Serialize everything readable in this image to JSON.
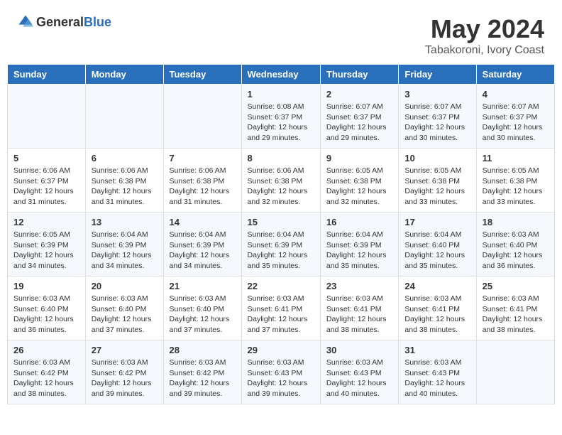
{
  "header": {
    "logo_general": "General",
    "logo_blue": "Blue",
    "month_year": "May 2024",
    "location": "Tabakoroni, Ivory Coast"
  },
  "weekdays": [
    "Sunday",
    "Monday",
    "Tuesday",
    "Wednesday",
    "Thursday",
    "Friday",
    "Saturday"
  ],
  "weeks": [
    [
      {
        "day": "",
        "info": ""
      },
      {
        "day": "",
        "info": ""
      },
      {
        "day": "",
        "info": ""
      },
      {
        "day": "1",
        "info": "Sunrise: 6:08 AM\nSunset: 6:37 PM\nDaylight: 12 hours\nand 29 minutes."
      },
      {
        "day": "2",
        "info": "Sunrise: 6:07 AM\nSunset: 6:37 PM\nDaylight: 12 hours\nand 29 minutes."
      },
      {
        "day": "3",
        "info": "Sunrise: 6:07 AM\nSunset: 6:37 PM\nDaylight: 12 hours\nand 30 minutes."
      },
      {
        "day": "4",
        "info": "Sunrise: 6:07 AM\nSunset: 6:37 PM\nDaylight: 12 hours\nand 30 minutes."
      }
    ],
    [
      {
        "day": "5",
        "info": "Sunrise: 6:06 AM\nSunset: 6:37 PM\nDaylight: 12 hours\nand 31 minutes."
      },
      {
        "day": "6",
        "info": "Sunrise: 6:06 AM\nSunset: 6:38 PM\nDaylight: 12 hours\nand 31 minutes."
      },
      {
        "day": "7",
        "info": "Sunrise: 6:06 AM\nSunset: 6:38 PM\nDaylight: 12 hours\nand 31 minutes."
      },
      {
        "day": "8",
        "info": "Sunrise: 6:06 AM\nSunset: 6:38 PM\nDaylight: 12 hours\nand 32 minutes."
      },
      {
        "day": "9",
        "info": "Sunrise: 6:05 AM\nSunset: 6:38 PM\nDaylight: 12 hours\nand 32 minutes."
      },
      {
        "day": "10",
        "info": "Sunrise: 6:05 AM\nSunset: 6:38 PM\nDaylight: 12 hours\nand 33 minutes."
      },
      {
        "day": "11",
        "info": "Sunrise: 6:05 AM\nSunset: 6:38 PM\nDaylight: 12 hours\nand 33 minutes."
      }
    ],
    [
      {
        "day": "12",
        "info": "Sunrise: 6:05 AM\nSunset: 6:39 PM\nDaylight: 12 hours\nand 34 minutes."
      },
      {
        "day": "13",
        "info": "Sunrise: 6:04 AM\nSunset: 6:39 PM\nDaylight: 12 hours\nand 34 minutes."
      },
      {
        "day": "14",
        "info": "Sunrise: 6:04 AM\nSunset: 6:39 PM\nDaylight: 12 hours\nand 34 minutes."
      },
      {
        "day": "15",
        "info": "Sunrise: 6:04 AM\nSunset: 6:39 PM\nDaylight: 12 hours\nand 35 minutes."
      },
      {
        "day": "16",
        "info": "Sunrise: 6:04 AM\nSunset: 6:39 PM\nDaylight: 12 hours\nand 35 minutes."
      },
      {
        "day": "17",
        "info": "Sunrise: 6:04 AM\nSunset: 6:40 PM\nDaylight: 12 hours\nand 35 minutes."
      },
      {
        "day": "18",
        "info": "Sunrise: 6:03 AM\nSunset: 6:40 PM\nDaylight: 12 hours\nand 36 minutes."
      }
    ],
    [
      {
        "day": "19",
        "info": "Sunrise: 6:03 AM\nSunset: 6:40 PM\nDaylight: 12 hours\nand 36 minutes."
      },
      {
        "day": "20",
        "info": "Sunrise: 6:03 AM\nSunset: 6:40 PM\nDaylight: 12 hours\nand 37 minutes."
      },
      {
        "day": "21",
        "info": "Sunrise: 6:03 AM\nSunset: 6:40 PM\nDaylight: 12 hours\nand 37 minutes."
      },
      {
        "day": "22",
        "info": "Sunrise: 6:03 AM\nSunset: 6:41 PM\nDaylight: 12 hours\nand 37 minutes."
      },
      {
        "day": "23",
        "info": "Sunrise: 6:03 AM\nSunset: 6:41 PM\nDaylight: 12 hours\nand 38 minutes."
      },
      {
        "day": "24",
        "info": "Sunrise: 6:03 AM\nSunset: 6:41 PM\nDaylight: 12 hours\nand 38 minutes."
      },
      {
        "day": "25",
        "info": "Sunrise: 6:03 AM\nSunset: 6:41 PM\nDaylight: 12 hours\nand 38 minutes."
      }
    ],
    [
      {
        "day": "26",
        "info": "Sunrise: 6:03 AM\nSunset: 6:42 PM\nDaylight: 12 hours\nand 38 minutes."
      },
      {
        "day": "27",
        "info": "Sunrise: 6:03 AM\nSunset: 6:42 PM\nDaylight: 12 hours\nand 39 minutes."
      },
      {
        "day": "28",
        "info": "Sunrise: 6:03 AM\nSunset: 6:42 PM\nDaylight: 12 hours\nand 39 minutes."
      },
      {
        "day": "29",
        "info": "Sunrise: 6:03 AM\nSunset: 6:43 PM\nDaylight: 12 hours\nand 39 minutes."
      },
      {
        "day": "30",
        "info": "Sunrise: 6:03 AM\nSunset: 6:43 PM\nDaylight: 12 hours\nand 40 minutes."
      },
      {
        "day": "31",
        "info": "Sunrise: 6:03 AM\nSunset: 6:43 PM\nDaylight: 12 hours\nand 40 minutes."
      },
      {
        "day": "",
        "info": ""
      }
    ]
  ]
}
